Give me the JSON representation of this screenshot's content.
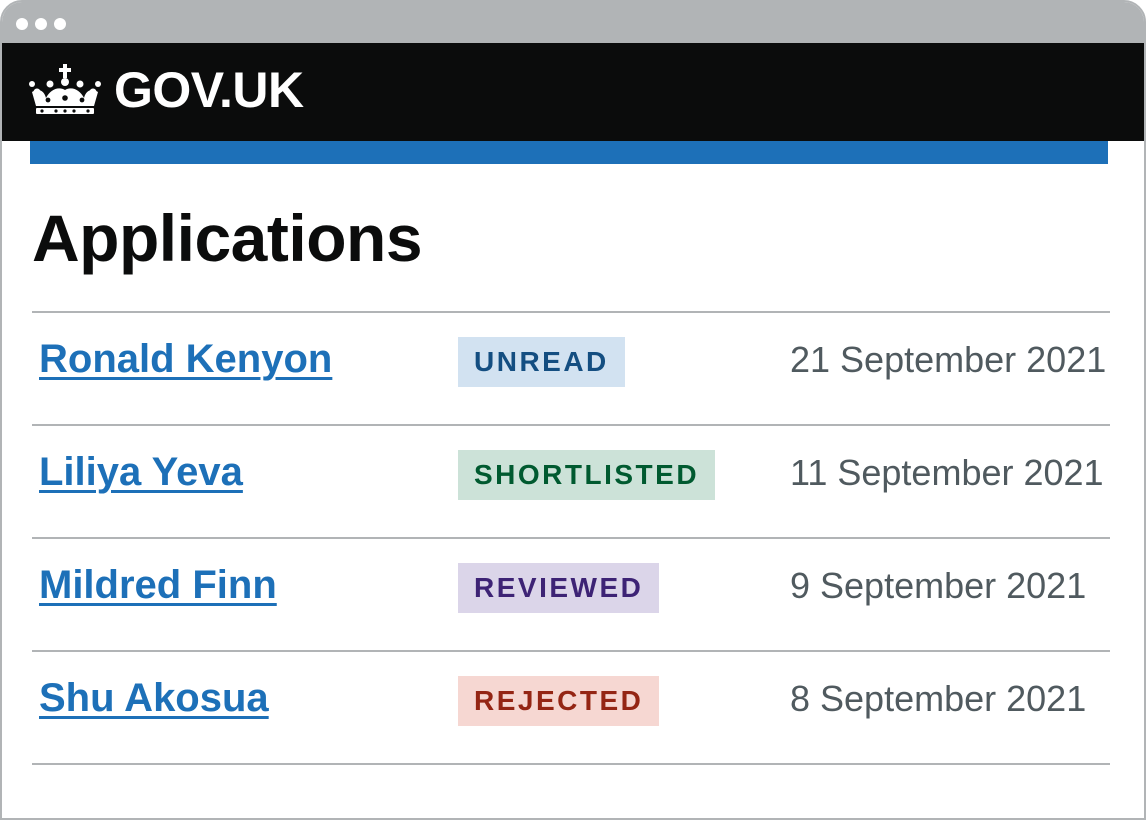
{
  "window": {
    "controls": [
      "dot",
      "dot",
      "dot"
    ]
  },
  "header": {
    "logo_icon": "crown-icon",
    "brand": "GOV.UK"
  },
  "colors": {
    "header_bg": "#0b0c0c",
    "accent_blue": "#1d70b8",
    "text": "#0b0c0c",
    "secondary_text": "#505a5f",
    "border": "#b1b4b6"
  },
  "page": {
    "title": "Applications"
  },
  "applications": [
    {
      "name": "Ronald Kenyon",
      "status": "UNREAD",
      "status_color": "#144e81",
      "date": "21 September 2021"
    },
    {
      "name": "Liliya Yeva",
      "status": "SHORTLISTED",
      "status_color": "#005a30",
      "date": "11 September 2021"
    },
    {
      "name": "Mildred Finn",
      "status": "REVIEWED",
      "status_color": "#3d2375",
      "date": "9 September 2021"
    },
    {
      "name": "Shu Akosua",
      "status": "REJECTED",
      "status_color": "#942514",
      "date": "8 September 2021"
    }
  ]
}
